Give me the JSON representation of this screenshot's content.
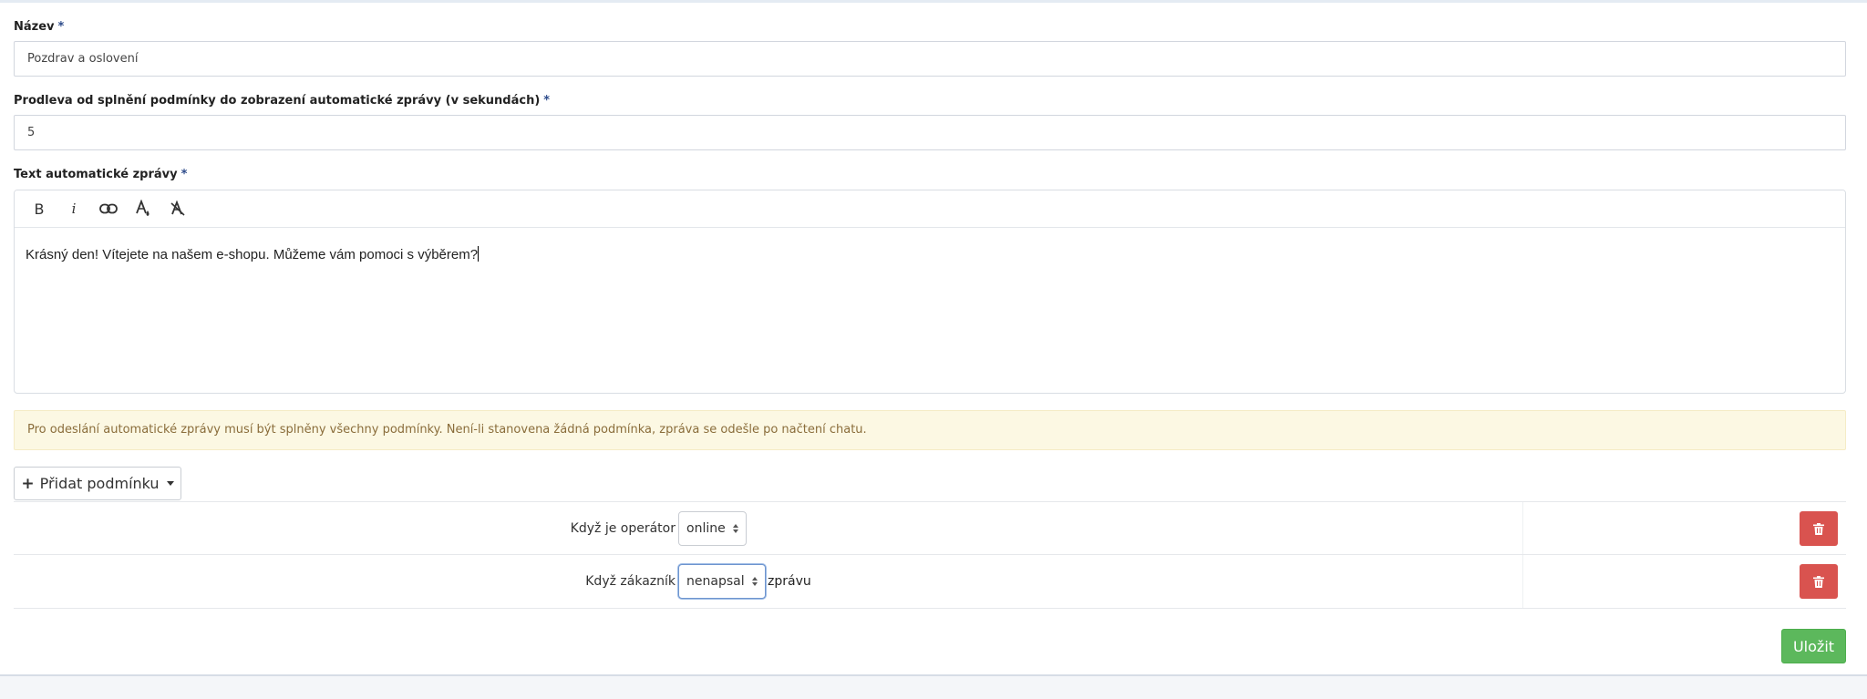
{
  "form": {
    "name_label": "Název",
    "name_value": "Pozdrav a oslovení",
    "delay_label": "Prodleva od splnění podmínky do zobrazení automatické zprávy (v sekundách)",
    "delay_value": "5",
    "message_label": "Text automatické zprávy",
    "required_mark": "*",
    "editor": {
      "tools": [
        {
          "name": "bold",
          "glyph": "B"
        },
        {
          "name": "italic",
          "glyph": "i"
        },
        {
          "name": "link",
          "glyph": "link"
        },
        {
          "name": "text-color",
          "glyph": "color"
        },
        {
          "name": "clear-format",
          "glyph": "clear"
        }
      ],
      "content": "Krásný den! Vítejete na našem e-shopu. Můžeme vám pomoci s výběrem?"
    },
    "alert_text": "Pro odeslání automatické zprávy musí být splněny všechny podmínky. Není-li stanovena žádná podmínka, zpráva se odešle po načtení chatu.",
    "add_condition_label": "Přidat podmínku",
    "conditions": [
      {
        "label": "Když je operátor",
        "value": "online",
        "suffix": ""
      },
      {
        "label": "Když zákazník",
        "value": "nenapsal",
        "suffix": "zprávu"
      }
    ],
    "save_label": "Uložit"
  },
  "colors": {
    "delete": "#d9534f",
    "save": "#5cb85c",
    "alert_bg": "#fcf8e3",
    "alert_text": "#8a6d3b"
  }
}
